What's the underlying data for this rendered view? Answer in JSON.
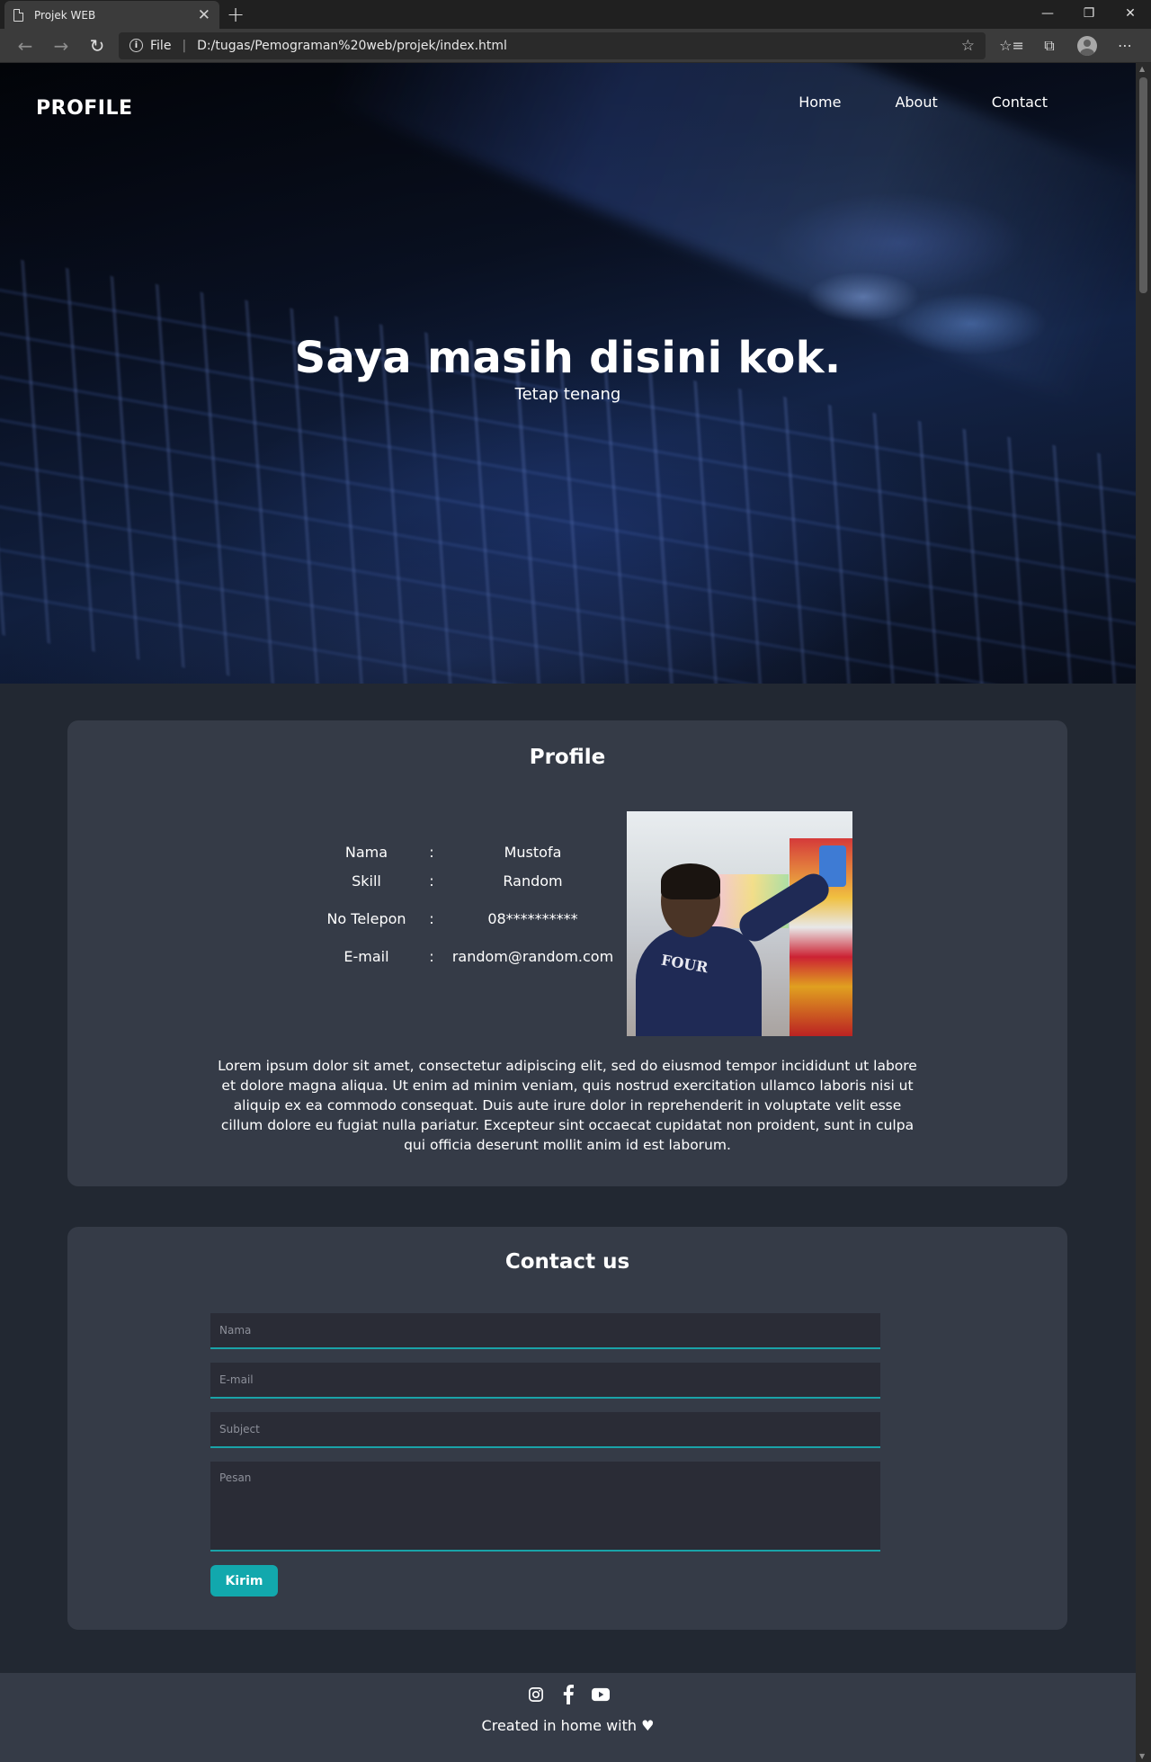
{
  "browser": {
    "tab_title": "Projek WEB",
    "tab_close": "✕",
    "new_tab": "+",
    "address_prefix": "File",
    "url": "D:/tugas/Pemograman%20web/projek/index.html"
  },
  "header": {
    "brand": "PROFILE",
    "nav": [
      "Home",
      "About",
      "Contact"
    ]
  },
  "hero": {
    "title": "Saya masih disini kok.",
    "subtitle": "Tetap tenang"
  },
  "profile": {
    "heading": "Profile",
    "rows": [
      {
        "label": "Nama",
        "sep": ":",
        "value": "Mustofa"
      },
      {
        "label": "Skill",
        "sep": ":",
        "value": "Random"
      },
      {
        "label": "No Telepon",
        "sep": ":",
        "value": "08**********"
      },
      {
        "label": "E-mail",
        "sep": ":",
        "value": "random@random.com"
      }
    ],
    "photo_text": "FOUR",
    "about": "Lorem ipsum dolor sit amet, consectetur adipiscing elit, sed do eiusmod tempor incididunt ut labore et dolore magna aliqua. Ut enim ad minim veniam, quis nostrud exercitation ullamco laboris nisi ut aliquip ex ea commodo consequat. Duis aute irure dolor in reprehenderit in voluptate velit esse cillum dolore eu fugiat nulla pariatur. Excepteur sint occaecat cupidatat non proident, sunt in culpa qui officia deserunt mollit anim id est laborum."
  },
  "contact": {
    "heading": "Contact us",
    "placeholders": {
      "name": "Nama",
      "email": "E-mail",
      "subject": "Subject",
      "message": "Pesan"
    },
    "submit_label": "Kirim"
  },
  "footer": {
    "icons": [
      "instagram-icon",
      "facebook-icon",
      "youtube-icon"
    ],
    "credit": "Created in home with ♥"
  },
  "colors": {
    "accent": "#12a8ad",
    "page_bg": "#222832",
    "card_bg": "#353b47"
  }
}
